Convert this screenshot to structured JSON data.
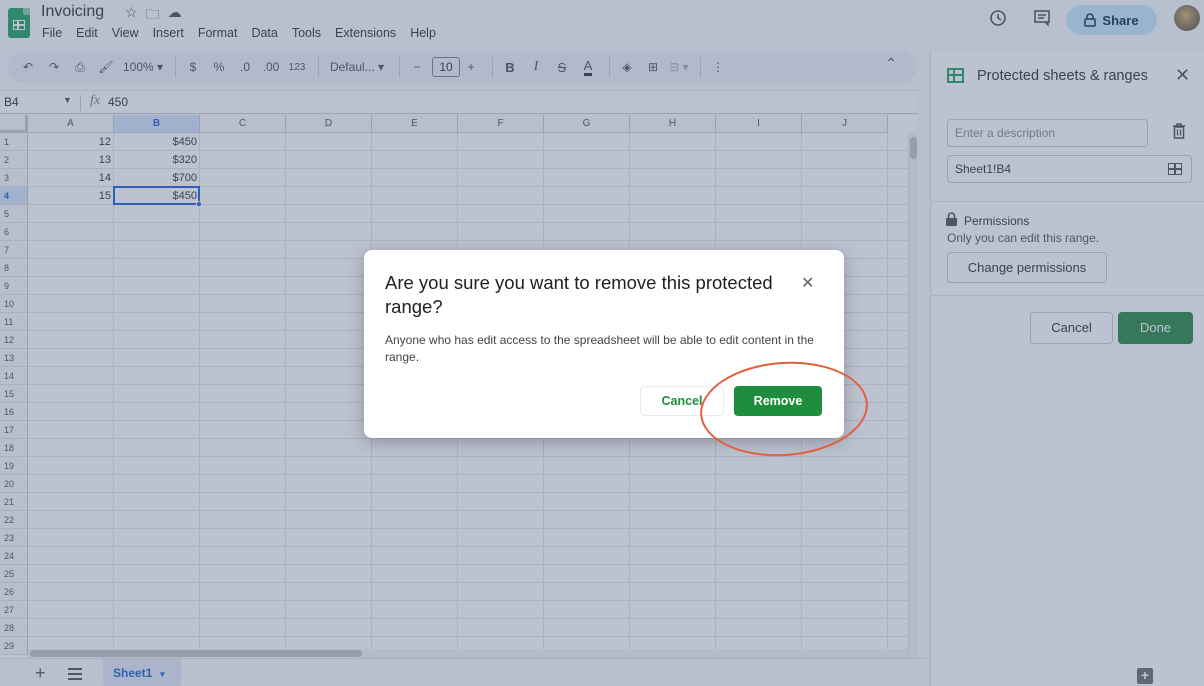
{
  "app": {
    "doc_title": "Invoicing",
    "menus": [
      "File",
      "Edit",
      "View",
      "Insert",
      "Format",
      "Data",
      "Tools",
      "Extensions",
      "Help"
    ],
    "share_label": "Share"
  },
  "toolbar": {
    "zoom": "100%",
    "currency": "$",
    "percent": "%",
    "dec_decrease": ".0",
    "dec_increase": ".00",
    "number_format": "123",
    "font": "Defaul...",
    "font_size": "10",
    "bold": "B",
    "italic": "I",
    "strike": "S",
    "text_color": "A"
  },
  "formula_bar": {
    "name_box": "B4",
    "fx": "fx",
    "value": "450"
  },
  "grid": {
    "columns": [
      "A",
      "B",
      "C",
      "D",
      "E",
      "F",
      "G",
      "H",
      "I",
      "J"
    ],
    "rows": [
      "1",
      "2",
      "3",
      "4",
      "5",
      "6",
      "7",
      "8",
      "9",
      "10",
      "11",
      "12",
      "13",
      "14",
      "15",
      "16",
      "17",
      "18",
      "19",
      "20",
      "21",
      "22",
      "23",
      "24",
      "25",
      "26",
      "27",
      "28",
      "29"
    ],
    "cells": [
      {
        "a": "12",
        "b": "$450"
      },
      {
        "a": "13",
        "b": "$320"
      },
      {
        "a": "14",
        "b": "$700"
      },
      {
        "a": "15",
        "b": "$450"
      }
    ],
    "selected_cell": "B4"
  },
  "sheets": {
    "active_tab": "Sheet1"
  },
  "side_panel": {
    "title": "Protected sheets & ranges",
    "description_placeholder": "Enter a description",
    "range_value": "Sheet1!B4",
    "permissions_title": "Permissions",
    "permissions_desc": "Only you can edit this range.",
    "change_permissions_label": "Change permissions",
    "cancel_label": "Cancel",
    "done_label": "Done"
  },
  "dialog": {
    "title": "Are you sure you want to remove this protected range?",
    "body": "Anyone who has edit access to the spreadsheet will be able to edit content in the range.",
    "cancel_label": "Cancel",
    "remove_label": "Remove"
  },
  "colors": {
    "accent_green": "#1e8e3e",
    "selection_blue": "#0b57d0",
    "annotation_red": "#e0603f"
  }
}
